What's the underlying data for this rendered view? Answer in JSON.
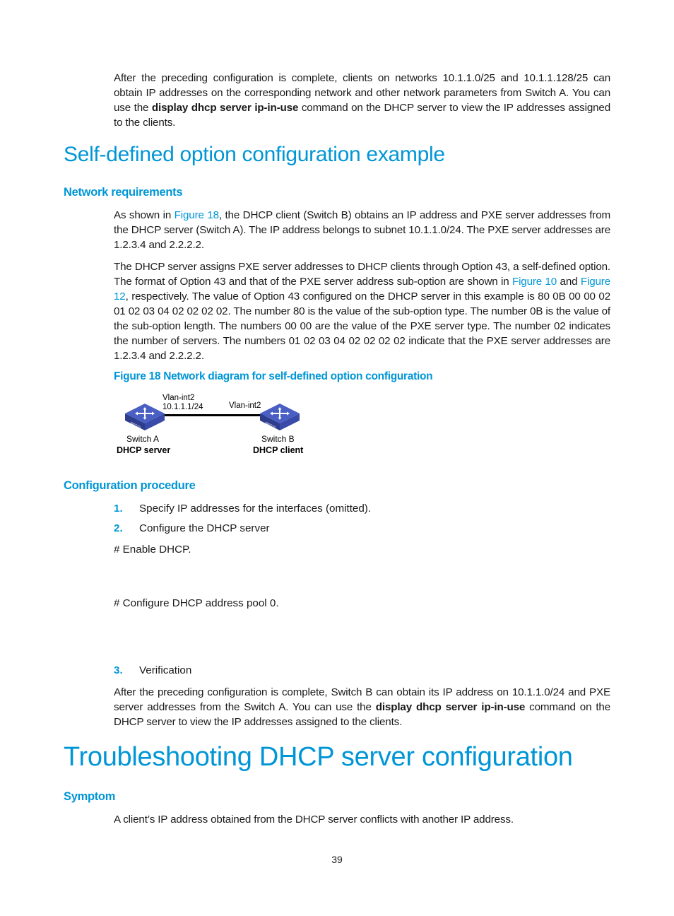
{
  "intro_paragraph": {
    "part1": "After the preceding configuration is complete, clients on networks 10.1.1.0/25 and 10.1.1.128/25 can obtain IP addresses on the corresponding network and other network parameters from Switch A. You can use the ",
    "command": "display dhcp server ip-in-use",
    "part2": " command on the DHCP server to view the IP addresses assigned to the clients."
  },
  "section1": {
    "title": "Self-defined option configuration example",
    "network_requirements": {
      "heading": "Network requirements",
      "para1": {
        "pre": "As shown in ",
        "link": "Figure 18",
        "post": ", the DHCP client (Switch B) obtains an IP address and PXE server addresses from the DHCP server (Switch A). The IP address belongs to subnet 10.1.1.0/24. The PXE server addresses are 1.2.3.4 and 2.2.2.2."
      },
      "para2": {
        "pre": "The DHCP server assigns PXE server addresses to DHCP clients through Option 43, a self-defined option. The format of Option 43 and that of the PXE server address sub-option are shown in ",
        "link1": "Figure 10",
        "mid": " and ",
        "link2": "Figure 12",
        "post": ", respectively. The value of Option 43 configured on the DHCP server in this example is 80 0B 00 00 02 01 02 03 04 02 02 02 02. The number 80 is the value of the sub-option type. The number 0B is the value of the sub-option length. The numbers 00 00 are the value of the PXE server type. The number 02 indicates the number of servers. The numbers 01 02 03 04 02 02 02 02 indicate that the PXE server addresses are 1.2.3.4 and 2.2.2.2."
      }
    },
    "figure": {
      "caption": "Figure 18 Network diagram for self-defined option configuration",
      "switch_a": {
        "name": "Switch A",
        "role": "DHCP server",
        "iface": "Vlan-int2",
        "ip": "10.1.1.1/24"
      },
      "switch_b": {
        "name": "Switch B",
        "role": "DHCP client",
        "iface": "Vlan-int2"
      },
      "device_label": "SWITCH"
    },
    "config_procedure": {
      "heading": "Configuration procedure",
      "steps": [
        {
          "num": "1.",
          "text": "Specify IP addresses for the interfaces (omitted)."
        },
        {
          "num": "2.",
          "text": "Configure the DHCP server"
        },
        {
          "num": "3.",
          "text": "Verification"
        }
      ],
      "comment1": "# Enable DHCP.",
      "comment2": "# Configure DHCP address pool 0.",
      "verification": {
        "part1": "After the preceding configuration is complete, Switch B can obtain its IP address on 10.1.1.0/24 and PXE server addresses from the Switch A. You can use the ",
        "command": "display dhcp server ip-in-use",
        "part2": " command on the DHCP server to view the IP addresses assigned to the clients."
      }
    }
  },
  "section2": {
    "title": "Troubleshooting DHCP server configuration",
    "symptom": {
      "heading": "Symptom",
      "text": "A client’s IP address obtained from the DHCP server conflicts with another IP address."
    }
  },
  "page_number": "39",
  "colors": {
    "accent": "#0096d6",
    "text": "#1a1a1a",
    "switch_blue": "#3d4fb0"
  }
}
